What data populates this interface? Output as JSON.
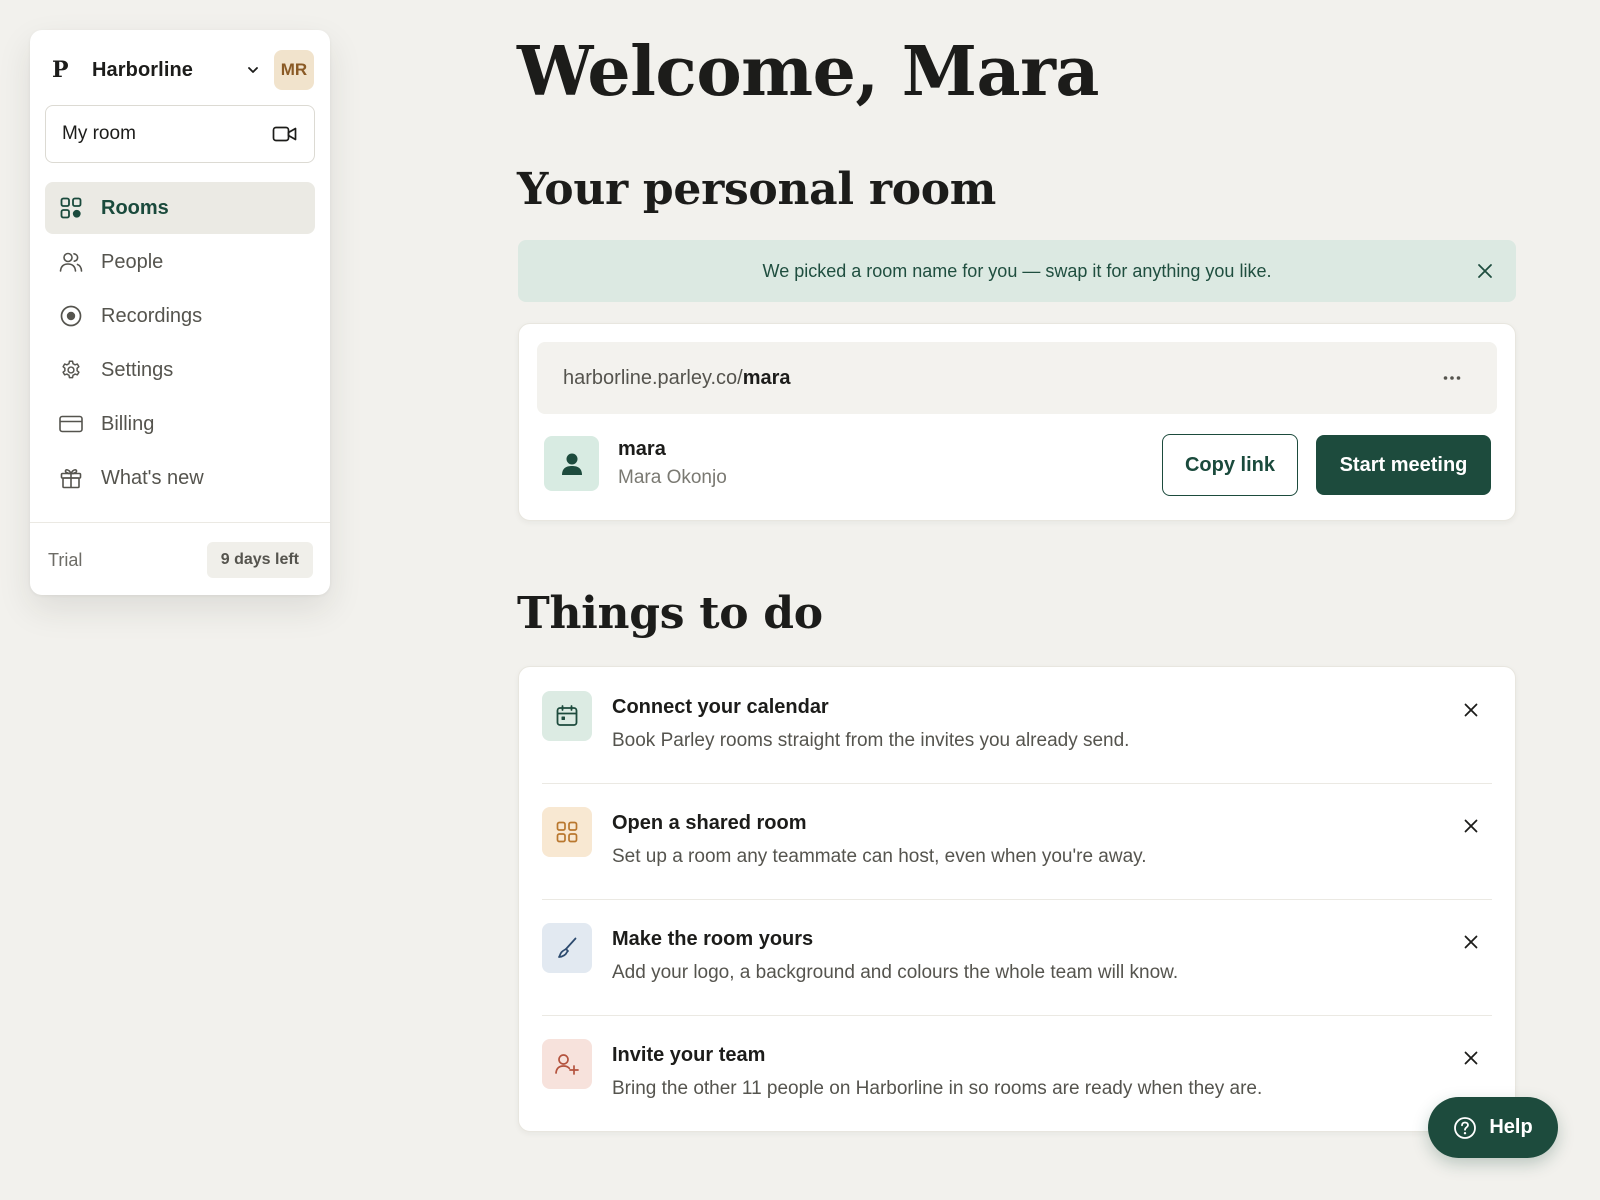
{
  "sidebar": {
    "workspace": {
      "logo": "P",
      "name": "Harborline",
      "avatar_initials": "MR"
    },
    "my_room": {
      "label": "My room",
      "icon": "video-camera-icon"
    },
    "nav": [
      {
        "label": "Rooms",
        "icon": "grid-icon",
        "active": true
      },
      {
        "label": "People",
        "icon": "people-icon",
        "active": false
      },
      {
        "label": "Recordings",
        "icon": "record-icon",
        "active": false
      },
      {
        "label": "Settings",
        "icon": "gear-icon",
        "active": false
      },
      {
        "label": "Billing",
        "icon": "credit-card-icon",
        "active": false
      },
      {
        "label": "What's new",
        "icon": "gift-icon",
        "active": false
      }
    ],
    "trial": {
      "label": "Trial",
      "badge": "9 days left"
    }
  },
  "main": {
    "welcome": "Welcome, Mara",
    "personal_room": {
      "heading": "Your personal room",
      "banner": "We picked a room name for you — swap it for anything you like.",
      "url_base": "harborline.parley.co/",
      "url_slug": "mara",
      "owner_handle": "mara",
      "owner_name": "Mara Okonjo",
      "copy_label": "Copy link",
      "start_label": "Start meeting"
    },
    "things_to_do": {
      "heading": "Things to do",
      "items": [
        {
          "title": "Connect your calendar",
          "description": "Book Parley rooms straight from the invites you already send.",
          "icon": "calendar-icon"
        },
        {
          "title": "Open a shared room",
          "description": "Set up a room any teammate can host, even when you're away.",
          "icon": "grid-icon"
        },
        {
          "title": "Make the room yours",
          "description": "Add your logo, a background and colours the whole team will know.",
          "icon": "paintbrush-icon"
        },
        {
          "title": "Invite your team",
          "description": "Bring the other 11 people on Harborline in so rooms are ready when they are.",
          "icon": "add-user-icon"
        }
      ]
    }
  },
  "help": {
    "label": "Help",
    "icon": "question-circle-icon"
  },
  "colors": {
    "background": "#f2f1ed",
    "brand_green": "#1d4b3d",
    "banner_green": "#dce9e2",
    "avatar_tan": "#f1e3cc"
  }
}
